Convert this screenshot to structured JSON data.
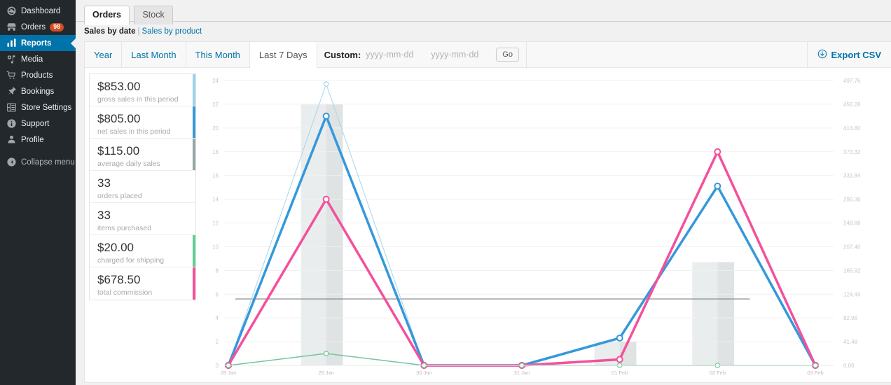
{
  "sidebar": {
    "items": [
      {
        "label": "Dashboard",
        "icon": "dashboard-icon",
        "badge": null,
        "active": false,
        "dim": false
      },
      {
        "label": "Orders",
        "icon": "store-icon",
        "badge": "98",
        "active": false,
        "dim": false
      },
      {
        "label": "Reports",
        "icon": "chart-bars-icon",
        "badge": null,
        "active": true,
        "dim": false
      },
      {
        "label": "Media",
        "icon": "media-icon",
        "badge": null,
        "active": false,
        "dim": false
      },
      {
        "label": "Products",
        "icon": "cart-icon",
        "badge": null,
        "active": false,
        "dim": false
      },
      {
        "label": "Bookings",
        "icon": "pin-icon",
        "badge": null,
        "active": false,
        "dim": false
      },
      {
        "label": "Store Settings",
        "icon": "store-settings-icon",
        "badge": null,
        "active": false,
        "dim": false
      },
      {
        "label": "Support",
        "icon": "info-icon",
        "badge": null,
        "active": false,
        "dim": false
      },
      {
        "label": "Profile",
        "icon": "user-icon",
        "badge": null,
        "active": false,
        "dim": false
      },
      {
        "label": "Collapse menu",
        "icon": "collapse-icon",
        "badge": null,
        "active": false,
        "dim": true
      }
    ],
    "colors": {
      "bg": "#23282d",
      "active_bg": "#0073aa",
      "badge_bg": "#d54e21"
    }
  },
  "page_tabs": [
    {
      "label": "Orders",
      "active": true
    },
    {
      "label": "Stock",
      "active": false
    }
  ],
  "subnav": {
    "current": "Sales by date",
    "separator": "|",
    "link": "Sales by product"
  },
  "filter_bar": {
    "ranges": [
      {
        "label": "Year",
        "active": false
      },
      {
        "label": "Last Month",
        "active": false
      },
      {
        "label": "This Month",
        "active": false
      },
      {
        "label": "Last 7 Days",
        "active": true
      }
    ],
    "custom_label": "Custom:",
    "from_value": "",
    "from_placeholder": "yyyy-mm-dd",
    "to_value": "",
    "to_placeholder": "yyyy-mm-dd",
    "go_label": "Go",
    "export_label": "Export CSV",
    "export_icon": "download-circle-icon",
    "link_color": "#0073aa"
  },
  "stats": [
    {
      "value": "$853.00",
      "label": "gross sales in this period",
      "color": "#9cd1ea"
    },
    {
      "value": "$805.00",
      "label": "net sales in this period",
      "color": "#3498db"
    },
    {
      "value": "$115.00",
      "label": "average daily sales",
      "color": "#95a5a6"
    },
    {
      "value": "33",
      "label": "orders placed",
      "color": "#ffffff"
    },
    {
      "value": "33",
      "label": "items purchased",
      "color": "#ffffff"
    },
    {
      "value": "$20.00",
      "label": "charged for shipping",
      "color": "#5ecf91"
    },
    {
      "value": "$678.50",
      "label": "total commission",
      "color": "#f55eа1"
    }
  ],
  "chart_data": {
    "type": "line",
    "title": "",
    "xlabel": "",
    "ylabel": "",
    "grid": true,
    "legend": "none",
    "categories": [
      "28 Jan",
      "29 Jan",
      "30 Jan",
      "31 Jan",
      "01 Feb",
      "02 Feb",
      "03 Feb"
    ],
    "left_axis": {
      "ticks": [
        0,
        2,
        4,
        6,
        8,
        10,
        12,
        14,
        16,
        18,
        20,
        22,
        24
      ],
      "ylim": [
        0,
        24
      ]
    },
    "right_axis": {
      "ticks": [
        "0.00",
        "41.48",
        "82.96",
        "124.44",
        "165.92",
        "207.40",
        "248.88",
        "290.36",
        "331.84",
        "373.32",
        "414.80",
        "456.28",
        "497.76"
      ],
      "ylim": [
        0,
        497.76
      ]
    },
    "series": [
      {
        "name": "gross sales",
        "color": "#a8d5ea",
        "width": 1,
        "markers": true,
        "axis": "left",
        "values": [
          0,
          23.7,
          0,
          0,
          0,
          0,
          0
        ]
      },
      {
        "name": "net sales",
        "color": "#3498db",
        "width": 3.5,
        "markers": true,
        "axis": "left",
        "values": [
          0,
          21.0,
          0,
          0,
          2.3,
          15.1,
          0
        ]
      },
      {
        "name": "commission",
        "color": "#f4509b",
        "width": 3.5,
        "markers": true,
        "axis": "left",
        "values": [
          0,
          14.0,
          0,
          0,
          0.5,
          18.0,
          0
        ]
      },
      {
        "name": "shipping",
        "color": "#72c79b",
        "width": 1.5,
        "markers": true,
        "axis": "left",
        "values": [
          0,
          1.0,
          0,
          0,
          0,
          0,
          0
        ]
      }
    ],
    "bars": {
      "name": "orders/items",
      "color": "#e9edee",
      "values": [
        0,
        22.0,
        0,
        0,
        2.0,
        8.7,
        0
      ]
    },
    "secondary_bars": {
      "color": "#dfe3e4",
      "values": [
        0,
        22.0,
        0,
        0,
        2.0,
        8.7,
        0
      ]
    },
    "average_line": {
      "value": 5.6,
      "color": "#7a8285"
    }
  }
}
